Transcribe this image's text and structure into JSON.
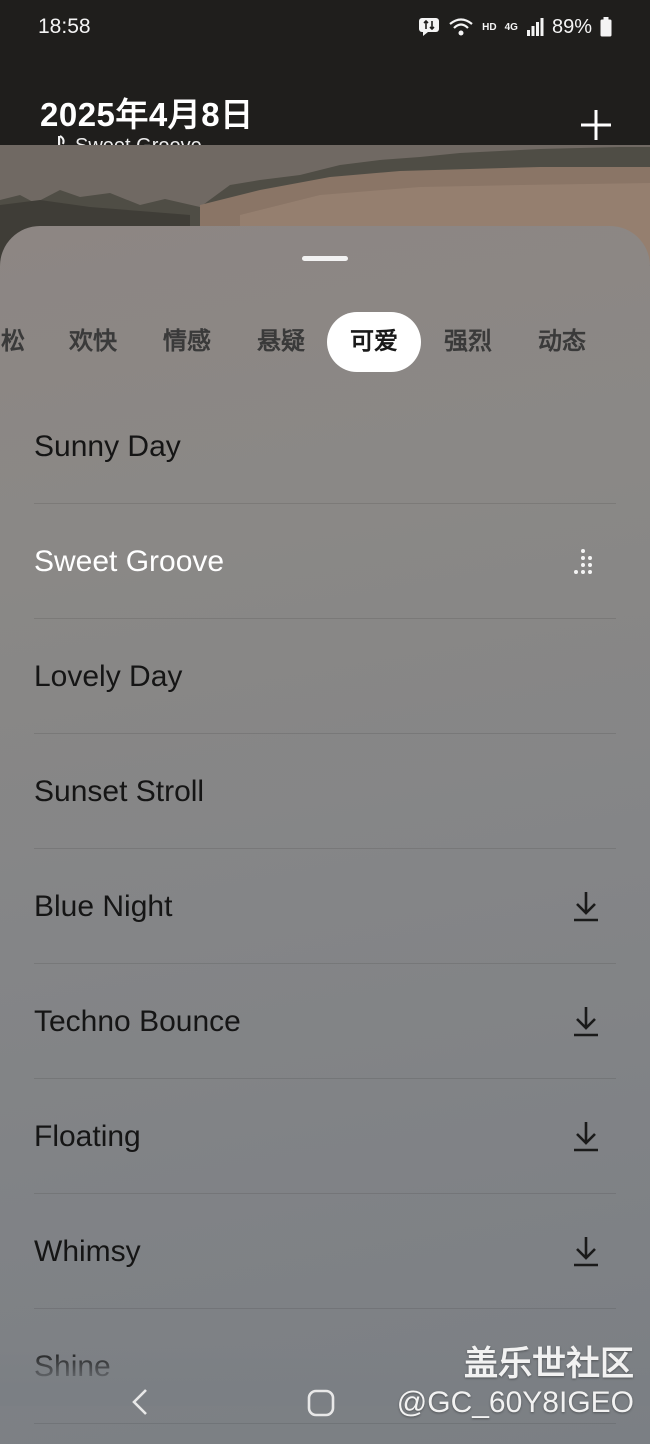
{
  "status_bar": {
    "time": "18:58",
    "network_label": "HD",
    "signal_label": "4G",
    "battery": "89%"
  },
  "header": {
    "date": "2025年4月8日",
    "now_playing": "Sweet Groove",
    "add_icon": "plus-icon"
  },
  "categories": {
    "tabs": [
      "松",
      "欢快",
      "情感",
      "悬疑",
      "可爱",
      "强烈",
      "动态"
    ],
    "selected": "可爱"
  },
  "tracks": [
    {
      "title": "Sunny Day",
      "action": "none"
    },
    {
      "title": "Sweet Groove",
      "action": "playing"
    },
    {
      "title": "Lovely Day",
      "action": "none"
    },
    {
      "title": "Sunset Stroll",
      "action": "none"
    },
    {
      "title": "Blue Night",
      "action": "download"
    },
    {
      "title": "Techno Bounce",
      "action": "download"
    },
    {
      "title": "Floating",
      "action": "download"
    },
    {
      "title": "Whimsy",
      "action": "download"
    },
    {
      "title": "Shine",
      "action": "none"
    }
  ],
  "watermark": {
    "line1": "盖乐世社区",
    "line2": "@GC_60Y8IGEO"
  },
  "colors": {
    "sheet": "#8a8886",
    "active_tab": "#ffffff",
    "text_dark": "#151515"
  }
}
